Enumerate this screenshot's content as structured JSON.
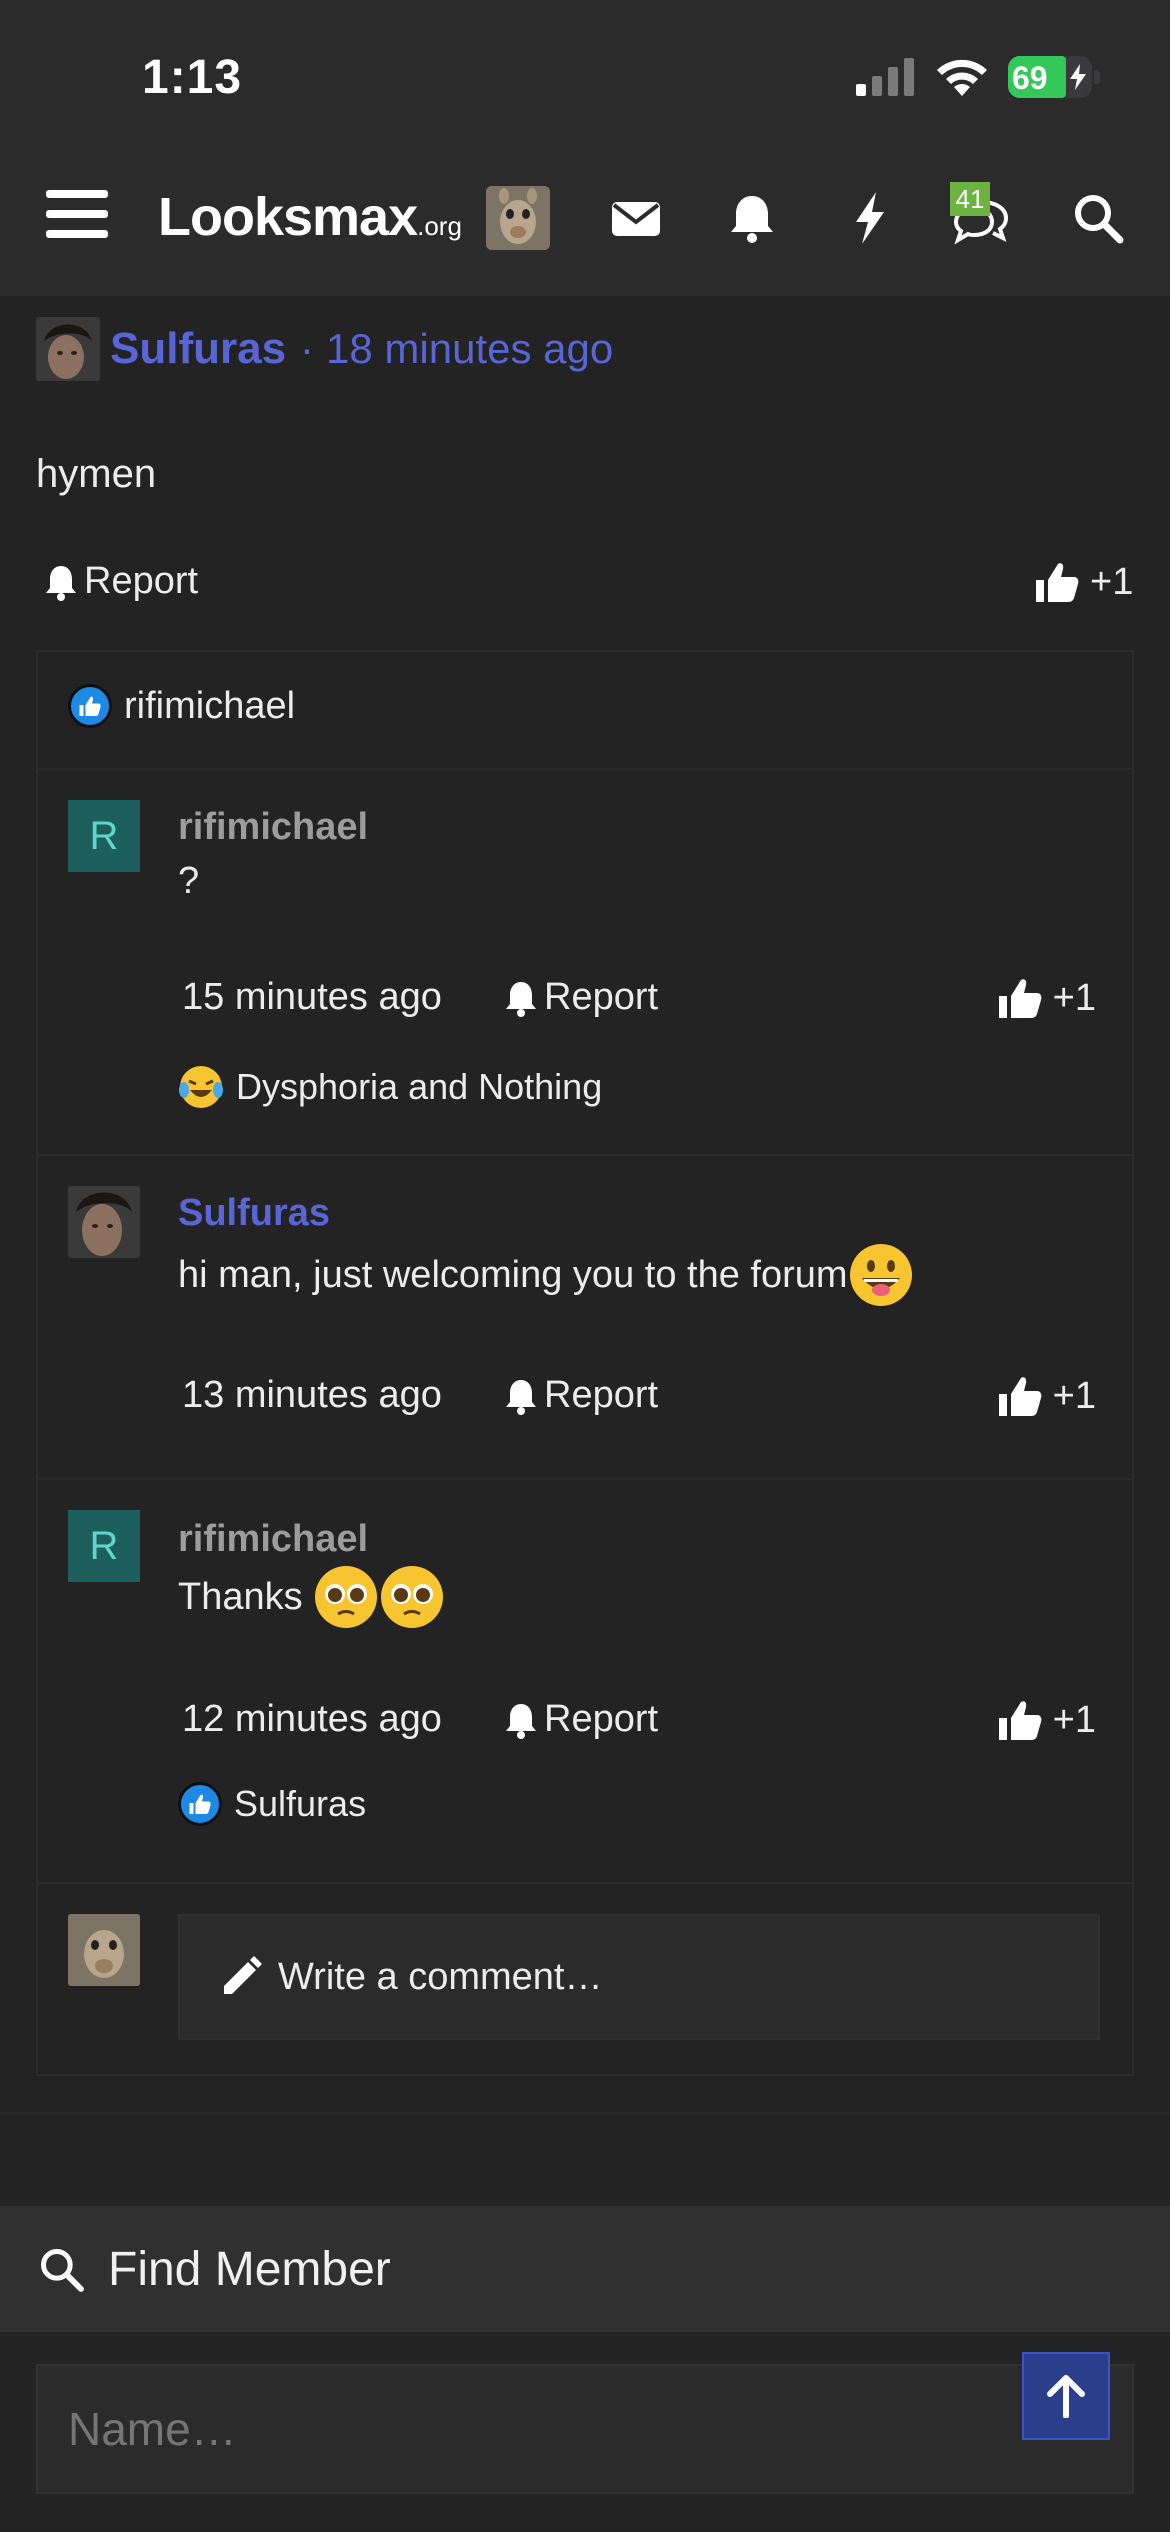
{
  "status_bar": {
    "time": "1:13",
    "battery_percent": "69"
  },
  "header": {
    "logo_main": "Looksmax",
    "logo_suffix": ".org",
    "alerts_badge": "41",
    "icons": [
      "menu-icon",
      "avatar",
      "envelope-icon",
      "bell-icon",
      "bolt-icon",
      "chat-bubbles-icon",
      "search-icon"
    ]
  },
  "post": {
    "author": "Sulfuras",
    "separator": "·",
    "time": "18 minutes ago",
    "body": "hymen",
    "report_label": "Report",
    "like_label": "+1",
    "reaction_user": "rifimichael"
  },
  "comments": [
    {
      "avatar_letter": "R",
      "user": "rifimichael",
      "text": "?",
      "time": "15 minutes ago",
      "report_label": "Report",
      "like_label": "+1",
      "reaction": "Dysphoria and Nothing"
    },
    {
      "user": "Sulfuras",
      "text": "hi man, just welcoming you to the forum",
      "time": "13 minutes ago",
      "report_label": "Report",
      "like_label": "+1"
    },
    {
      "avatar_letter": "R",
      "user": "rifimichael",
      "text": "Thanks",
      "time": "12 minutes ago",
      "report_label": "Report",
      "like_label": "+1",
      "reaction": "Sulfuras"
    }
  ],
  "write_comment": {
    "placeholder": "Write a comment…"
  },
  "find_member": {
    "title": "Find Member",
    "placeholder": "Name…"
  },
  "colors": {
    "accent_blue": "#5865d6",
    "badge_green": "#6cb33f",
    "like_blue": "#1e88e5",
    "to_top_button": "#2a3e8c"
  }
}
